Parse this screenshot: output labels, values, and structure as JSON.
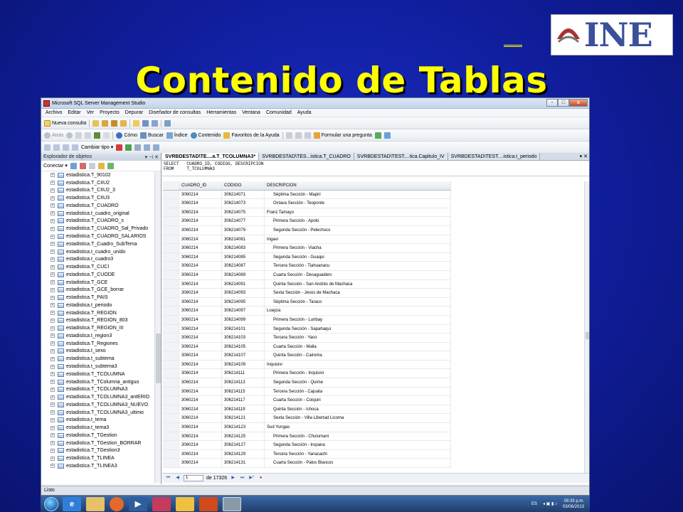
{
  "slide": {
    "title": "Contenido de Tablas",
    "logo_text": "INE"
  },
  "window": {
    "title": "Microsoft SQL Server Management Studio",
    "controls": [
      "-",
      "□",
      "x"
    ]
  },
  "menu": [
    "Archivo",
    "Editar",
    "Ver",
    "Proyecto",
    "Depurar",
    "Diseñador de consultas",
    "Herramientas",
    "Ventana",
    "Comunidad",
    "Ayuda"
  ],
  "toolbar1": {
    "new_query": "Nueva consulta"
  },
  "toolbar2": {
    "back": "Atrás",
    "how": "Cómo",
    "search": "Buscar",
    "index": "Índice",
    "contents": "Contenido",
    "favorites": "Favoritos de la Ayuda",
    "ask": "Formular una pregunta"
  },
  "toolbar3": {
    "change_type": "Cambiar tipo"
  },
  "explorer": {
    "title": "Explorador de objetos",
    "connect": "Conectar",
    "items": [
      "estadistica.T_90102",
      "estadistica.T_CIIU2",
      "estadistica.T_CIIU2_3",
      "estadistica.T_CIIU3",
      "estadistica.T_CUADRO",
      "estadistica.t_cuadro_original",
      "estadistica.T_CUADRO_s",
      "estadistica.T_CUADRO_Sal_Privado",
      "estadistica.T_CUADRO_SALARIOS",
      "estadistica.T_Cuadro_SubTema",
      "estadistica.t_cuadro_unido",
      "estadistica.t_cuadro3",
      "estadistica.T_CUCI",
      "estadistica.T_CUODE",
      "estadistica.T_GCE",
      "estadistica.T_GCE_borrar",
      "estadistica.T_PAIS",
      "estadistica.t_periodo",
      "estadistica.T_REGION",
      "estadistica.T_REGION_803",
      "estadistica.T_REGION_III",
      "estadistica.t_region3",
      "estadistica.T_Regiones",
      "estadistica.t_sexo",
      "estadistica.t_subtema",
      "estadistica.t_subtema3",
      "estadistica.T_TCOLUMNA",
      "estadistica.T_TColumna_antiguo",
      "estadistica.T_TCOLUMNA3",
      "estadistica.T_TCOLUMNA3_antERIO",
      "estadistica.T_TCOLUMNA3_NUEVO",
      "estadistica.T_TCOLUMNA3_ultimo",
      "estadistica.t_tema",
      "estadistica.t_tema3",
      "estadistica.T_TGestion",
      "estadistica.T_TGestion_BORRAR",
      "estadistica.T_TGestion3",
      "estadistica.T_TLINEA",
      "estadistica.T_TLINEA3"
    ]
  },
  "tabs": [
    "SVRBDESTAD\\TE....a.T_TCOLUMNA3*",
    "SVRBDESTAD\\TES...istica.T_CUADRO",
    "SVRBDESTAD\\TEST....tica.Capitulo_IV",
    "SVRBDESTAD\\TEST....istica.t_periodo"
  ],
  "sql": "SELECT   CUADRO_ID, CODIGO, DESCRIPCION\nFROM     T_TCOLUMNA3",
  "grid": {
    "headers": [
      "CUADRO_ID",
      "CODIGO",
      "DESCRIPCION"
    ],
    "rows": [
      [
        "3060214",
        "306214071",
        "Séptima Sección - Mapiri"
      ],
      [
        "3060214",
        "306214073",
        "Octava Sección - Teoponte"
      ],
      [
        "3060214",
        "306214075",
        "Franz Tamayo"
      ],
      [
        "3060214",
        "306214077",
        "Primera Sección - Apolo"
      ],
      [
        "3060214",
        "306214079",
        "Segunda Sección - Pelechuco"
      ],
      [
        "3060214",
        "306214081",
        "Ingavi"
      ],
      [
        "3060214",
        "306214083",
        "Primera Sección - Viacha"
      ],
      [
        "3060214",
        "306214085",
        "Segunda Sección - Guaqui"
      ],
      [
        "3060214",
        "306214087",
        "Tercera Sección - Tiahuanacu"
      ],
      [
        "3060214",
        "306214089",
        "Cuarta Sección - Desaguadero"
      ],
      [
        "3060214",
        "306214091",
        "Quinta Sección - San Andrés de Machaca"
      ],
      [
        "3060214",
        "306214093",
        "Sexta Sección - Jesús de Machaca"
      ],
      [
        "3060214",
        "306214095",
        "Séptima Sección - Taraco"
      ],
      [
        "3060214",
        "306214097",
        "Loayza"
      ],
      [
        "3060214",
        "306214099",
        "Primera Sección - Luribay"
      ],
      [
        "3060214",
        "306214101",
        "Segunda Sección - Sapahaqui"
      ],
      [
        "3060214",
        "306214103",
        "Tercera Sección - Yaco"
      ],
      [
        "3060214",
        "306214105",
        "Cuarta Sección - Malla"
      ],
      [
        "3060214",
        "306214107",
        "Quinta Sección - Cairoma"
      ],
      [
        "3060214",
        "306214109",
        "Inquisivi"
      ],
      [
        "3060214",
        "306214111",
        "Primera Sección - Inquisivi"
      ],
      [
        "3060214",
        "306214113",
        "Segunda Sección - Quime"
      ],
      [
        "3060214",
        "306214115",
        "Tercera Sección - Cajuata"
      ],
      [
        "3060214",
        "306214117",
        "Cuarta Sección - Colquiri"
      ],
      [
        "3060214",
        "306214119",
        "Quinta Sección - Ichoca"
      ],
      [
        "3060214",
        "306214121",
        "Sexta Sección - Villa Libertad Licoma"
      ],
      [
        "3060214",
        "306214123",
        "Sud Yungas"
      ],
      [
        "3060214",
        "306214125",
        "Primera Sección - Chulumani"
      ],
      [
        "3060214",
        "306214127",
        "Segunda Sección - Irupana"
      ],
      [
        "3060214",
        "306214129",
        "Tercera Sección - Yanacachi"
      ],
      [
        "3060214",
        "306214131",
        "Cuarta Sección - Palos Blancos"
      ]
    ],
    "indented": [
      true,
      true,
      false,
      true,
      true,
      false,
      true,
      true,
      true,
      true,
      true,
      true,
      true,
      false,
      true,
      true,
      true,
      true,
      true,
      false,
      true,
      true,
      true,
      true,
      true,
      true,
      false,
      true,
      true,
      true,
      true
    ]
  },
  "navigation": {
    "current": "1",
    "of_label": "de 17326"
  },
  "status": "Listo",
  "taskbar": {
    "lang": "ES",
    "time": "09:35 p.m.",
    "date": "03/06/2013"
  },
  "colors": {
    "title": "#ffff00",
    "background": "#1428b4",
    "tab_active": "#ffffff"
  }
}
